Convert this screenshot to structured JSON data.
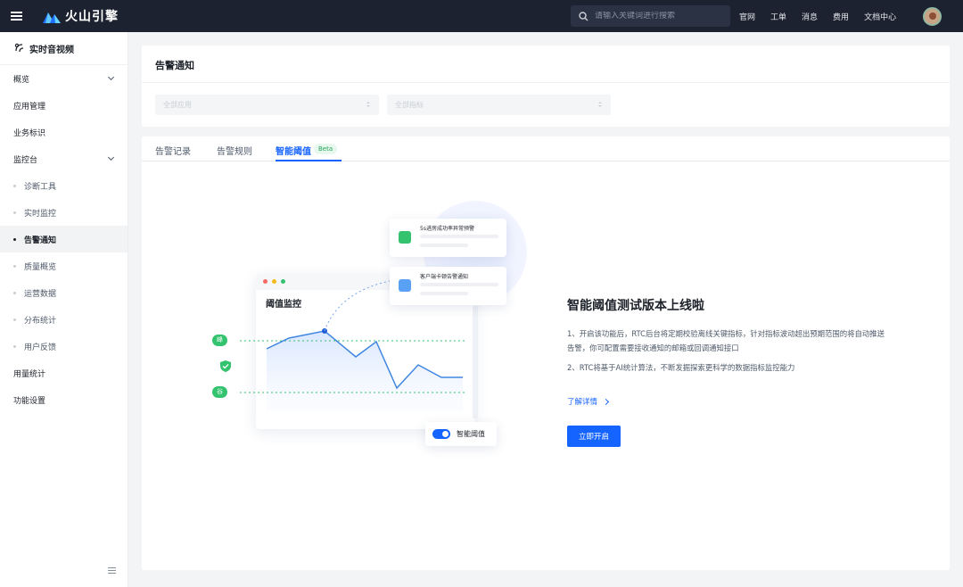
{
  "header": {
    "brand": "火山引擎",
    "search_placeholder": "请输入关键词进行搜索",
    "links": [
      "官网",
      "工单",
      "消息",
      "费用",
      "文档中心"
    ]
  },
  "sidebar": {
    "product": "实时音视频",
    "items": [
      {
        "label": "概览",
        "type": "group",
        "expanded": false
      },
      {
        "label": "应用管理",
        "type": "item"
      },
      {
        "label": "业务标识",
        "type": "item"
      },
      {
        "label": "监控台",
        "type": "group",
        "expanded": true
      },
      {
        "label": "诊断工具",
        "type": "sub"
      },
      {
        "label": "实时监控",
        "type": "sub"
      },
      {
        "label": "告警通知",
        "type": "sub",
        "active": true
      },
      {
        "label": "质量概览",
        "type": "sub"
      },
      {
        "label": "运营数据",
        "type": "sub"
      },
      {
        "label": "分布统计",
        "type": "sub"
      },
      {
        "label": "用户反馈",
        "type": "sub"
      },
      {
        "label": "用量统计",
        "type": "item"
      },
      {
        "label": "功能设置",
        "type": "item"
      }
    ]
  },
  "page": {
    "title": "告警通知",
    "filters": {
      "app_select": "全部应用",
      "metric_select": "全部指标"
    }
  },
  "tabs": [
    {
      "label": "告警记录"
    },
    {
      "label": "告警规则"
    },
    {
      "label": "智能阈值",
      "active": true,
      "badge": "Beta"
    }
  ],
  "illustration": {
    "chart_title": "阈值监控",
    "notify_1": "5s进房成功率异常预警",
    "notify_2": "客户端卡顿告警通知",
    "peak_tag": "峰值",
    "valley_tag": "谷值",
    "toggle_label": "智能阈值"
  },
  "promo": {
    "title": "智能阈值测试版本上线啦",
    "point_1": "1、开启该功能后，RTC后台将定期校验离线关键指标，针对指标波动超出预期范围的将自动推送告警，你可配置需要接收通知的邮箱或回调通知接口",
    "point_2": "2、RTC将基于AI统计算法，不断发掘探索更科学的数据指标监控能力",
    "learn_more": "了解详情",
    "enable_button": "立即开启"
  },
  "colors": {
    "topbar": "#1c2230",
    "primary": "#1664ff",
    "success": "#33c36f"
  }
}
